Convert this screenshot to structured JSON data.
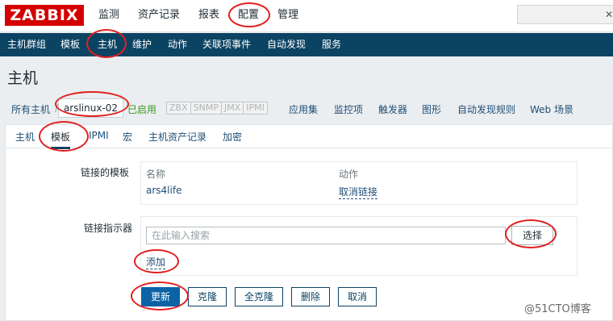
{
  "brand": {
    "logo": "ZABBIX",
    "color": "#d40000"
  },
  "top_nav": [
    "监测",
    "资产记录",
    "报表",
    "配置",
    "管理"
  ],
  "search": {
    "placeholder": ""
  },
  "sub_nav": [
    "主机群组",
    "模板",
    "主机",
    "维护",
    "动作",
    "关联项事件",
    "自动发现",
    "服务"
  ],
  "page_title": "主机",
  "host_nav": {
    "all_hosts": "所有主机",
    "separator": "/",
    "current_host": "arslinux-02",
    "status": "已启用",
    "availability": [
      "ZBX",
      "SNMP",
      "JMX",
      "IPMI"
    ],
    "links": [
      "应用集",
      "监控项",
      "触发器",
      "图形",
      "自动发现规则",
      "Web 场景"
    ]
  },
  "tabs": [
    "主机",
    "模板",
    "IPMI",
    "宏",
    "主机资产记录",
    "加密"
  ],
  "linked_templates": {
    "label": "链接的模板",
    "col_name": "名称",
    "col_action": "动作",
    "rows": [
      {
        "name": "ars4life",
        "action": "取消链接"
      }
    ]
  },
  "link_indicator": {
    "label": "链接指示器",
    "placeholder": "在此输入搜索",
    "select_button": "选择",
    "add_link": "添加"
  },
  "buttons": {
    "update": "更新",
    "clone": "克隆",
    "full_clone": "全克隆",
    "delete": "删除",
    "cancel": "取消"
  },
  "watermark": "@51CTO博客",
  "colors": {
    "header_bg": "#0b4363",
    "primary_button": "#0b62a4",
    "annotation": "#e02020"
  }
}
